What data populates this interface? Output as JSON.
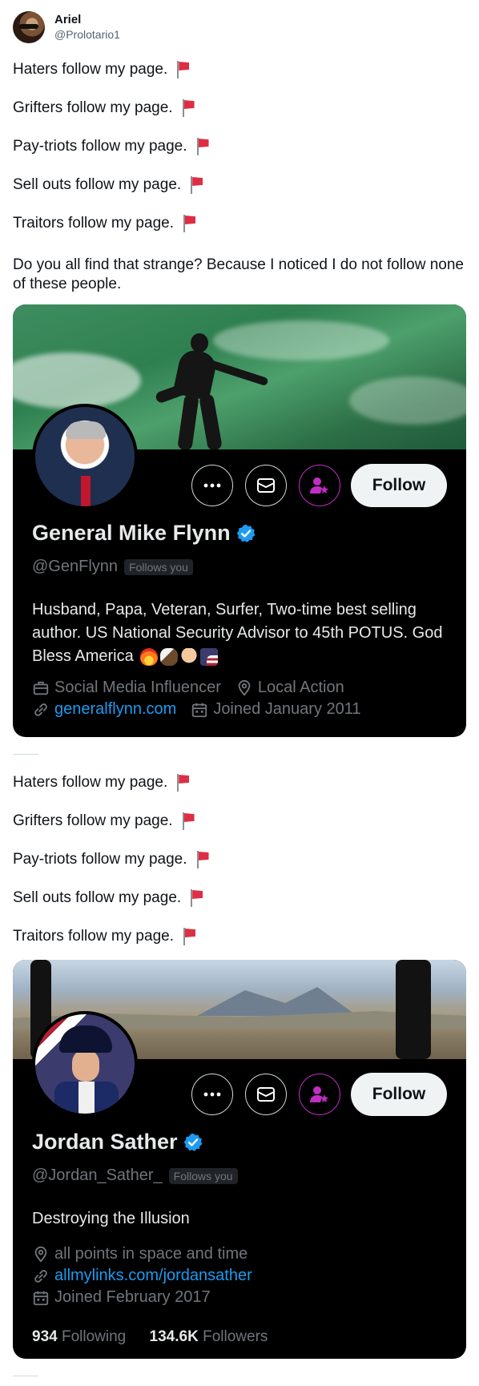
{
  "author": {
    "name": "Ariel",
    "handle": "@Prolotario1"
  },
  "lines_top": [
    "Haters follow my page.",
    "Grifters follow my page.",
    "Pay-triots follow my page.",
    "Sell outs follow my page.",
    "Traitors follow my page."
  ],
  "question": "Do you all find that strange? Because I noticed I do not follow none of these people.",
  "lines_bottom": [
    "Haters follow my page.",
    "Grifters follow my page.",
    "Pay-triots follow my page.",
    "Sell outs follow my page.",
    "Traitors follow my page."
  ],
  "profile1": {
    "name": "General Mike Flynn",
    "handle": "@GenFlynn",
    "follows_you": "Follows you",
    "bio": "Husband, Papa, Veteran, Surfer, Two-time best selling author. US National Security Advisor to 45th POTUS. God Bless America",
    "category": "Social Media Influencer",
    "location": "Local Action",
    "website": "generalflynn.com",
    "joined": "Joined January 2011",
    "follow_label": "Follow"
  },
  "profile2": {
    "name": "Jordan Sather",
    "handle": "@Jordan_Sather_",
    "follows_you": "Follows you",
    "bio": "Destroying the Illusion",
    "location": "all points in space and time",
    "website": "allmylinks.com/jordansather",
    "joined": "Joined February 2017",
    "following_count": "934",
    "following_label": "Following",
    "followers_count": "134.6K",
    "followers_label": "Followers",
    "follow_label": "Follow"
  },
  "colors": {
    "verified": "#1d9bf0",
    "subscribe": "#c02ec3",
    "flag": "#dd2e44",
    "link": "#1d9bf0"
  }
}
